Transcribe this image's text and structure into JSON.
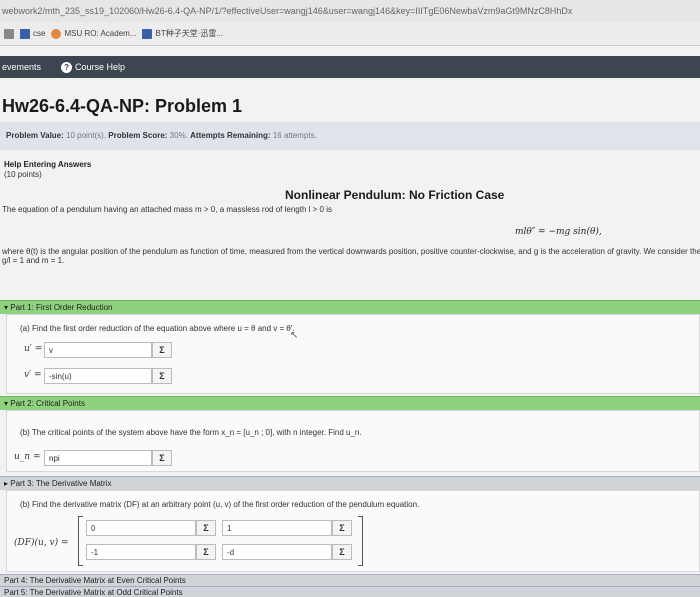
{
  "browser": {
    "url": "webwork2/mth_235_ss19_102060/Hw26-6.4-QA-NP/1/?effectiveUser=wangj146&user=wangj146&key=IIITgE06NewbaVzm9aGt9MNzC8HhDx",
    "bookmarks": [
      "cse",
      "MSU RO: Academ...",
      "BT种子天堂·迅雷..."
    ]
  },
  "nav": {
    "items": [
      "evements",
      "Course Help"
    ]
  },
  "page": {
    "title": "Hw26-6.4-QA-NP: Problem 1"
  },
  "info": {
    "value_label": "Problem Value:",
    "value": "10 point(s).",
    "score_label": "Problem Score:",
    "score": "30%.",
    "attempts_label": "Attempts Remaining:",
    "attempts": "16 attempts."
  },
  "problem": {
    "help_link": "Help Entering Answers",
    "points": "(10 points)",
    "case_title": "Nonlinear Pendulum: No Friction Case",
    "intro": "The equation of a pendulum having an attached mass m > 0, a massless rod of length l > 0 is",
    "equation": "mlθ″ = −mg sin(θ),",
    "where": "where θ(t) is the angular position of the pendulum as function of time, measured from the vertical downwards position, positive counter-clockwise, and g is the acceleration of gravity. We consider the",
    "consider": "g/l = 1 and m = 1."
  },
  "parts": [
    {
      "title": "Part 1: First Order Reduction",
      "question": "(a) Find the first order reduction of the equation above where u = θ and v = θ′.",
      "rows": [
        {
          "label": "u′ =",
          "value": "v"
        },
        {
          "label": "v′ =",
          "value": "-sin(u)"
        }
      ]
    },
    {
      "title": "Part 2: Critical Points",
      "question": "(b) The critical points of the system above have the form x_n = [u_n ; 0], with n integer. Find u_n.",
      "rows": [
        {
          "label": "u_n =",
          "value": "npi"
        }
      ]
    },
    {
      "title": "Part 3: The Derivative Matrix",
      "question": "(b) Find the derivative matrix (DF) at an arbitrary point (u, v) of the first order reduction of the pendulum equation.",
      "matrix_label": "(DF)(u, v) =",
      "matrix": [
        "0",
        "1",
        "-1",
        "-d"
      ]
    },
    {
      "title": "Part 4: The Derivative Matrix at Even Critical Points"
    },
    {
      "title": "Part 5: The Derivative Matrix at Odd Critical Points"
    }
  ],
  "sigma_symbol": "Σ",
  "colors": {
    "navbar": "#3d4650",
    "info_bar": "#dfe3ea",
    "part_green": "#8ed27d",
    "part_gray": "#cfd4d9"
  }
}
